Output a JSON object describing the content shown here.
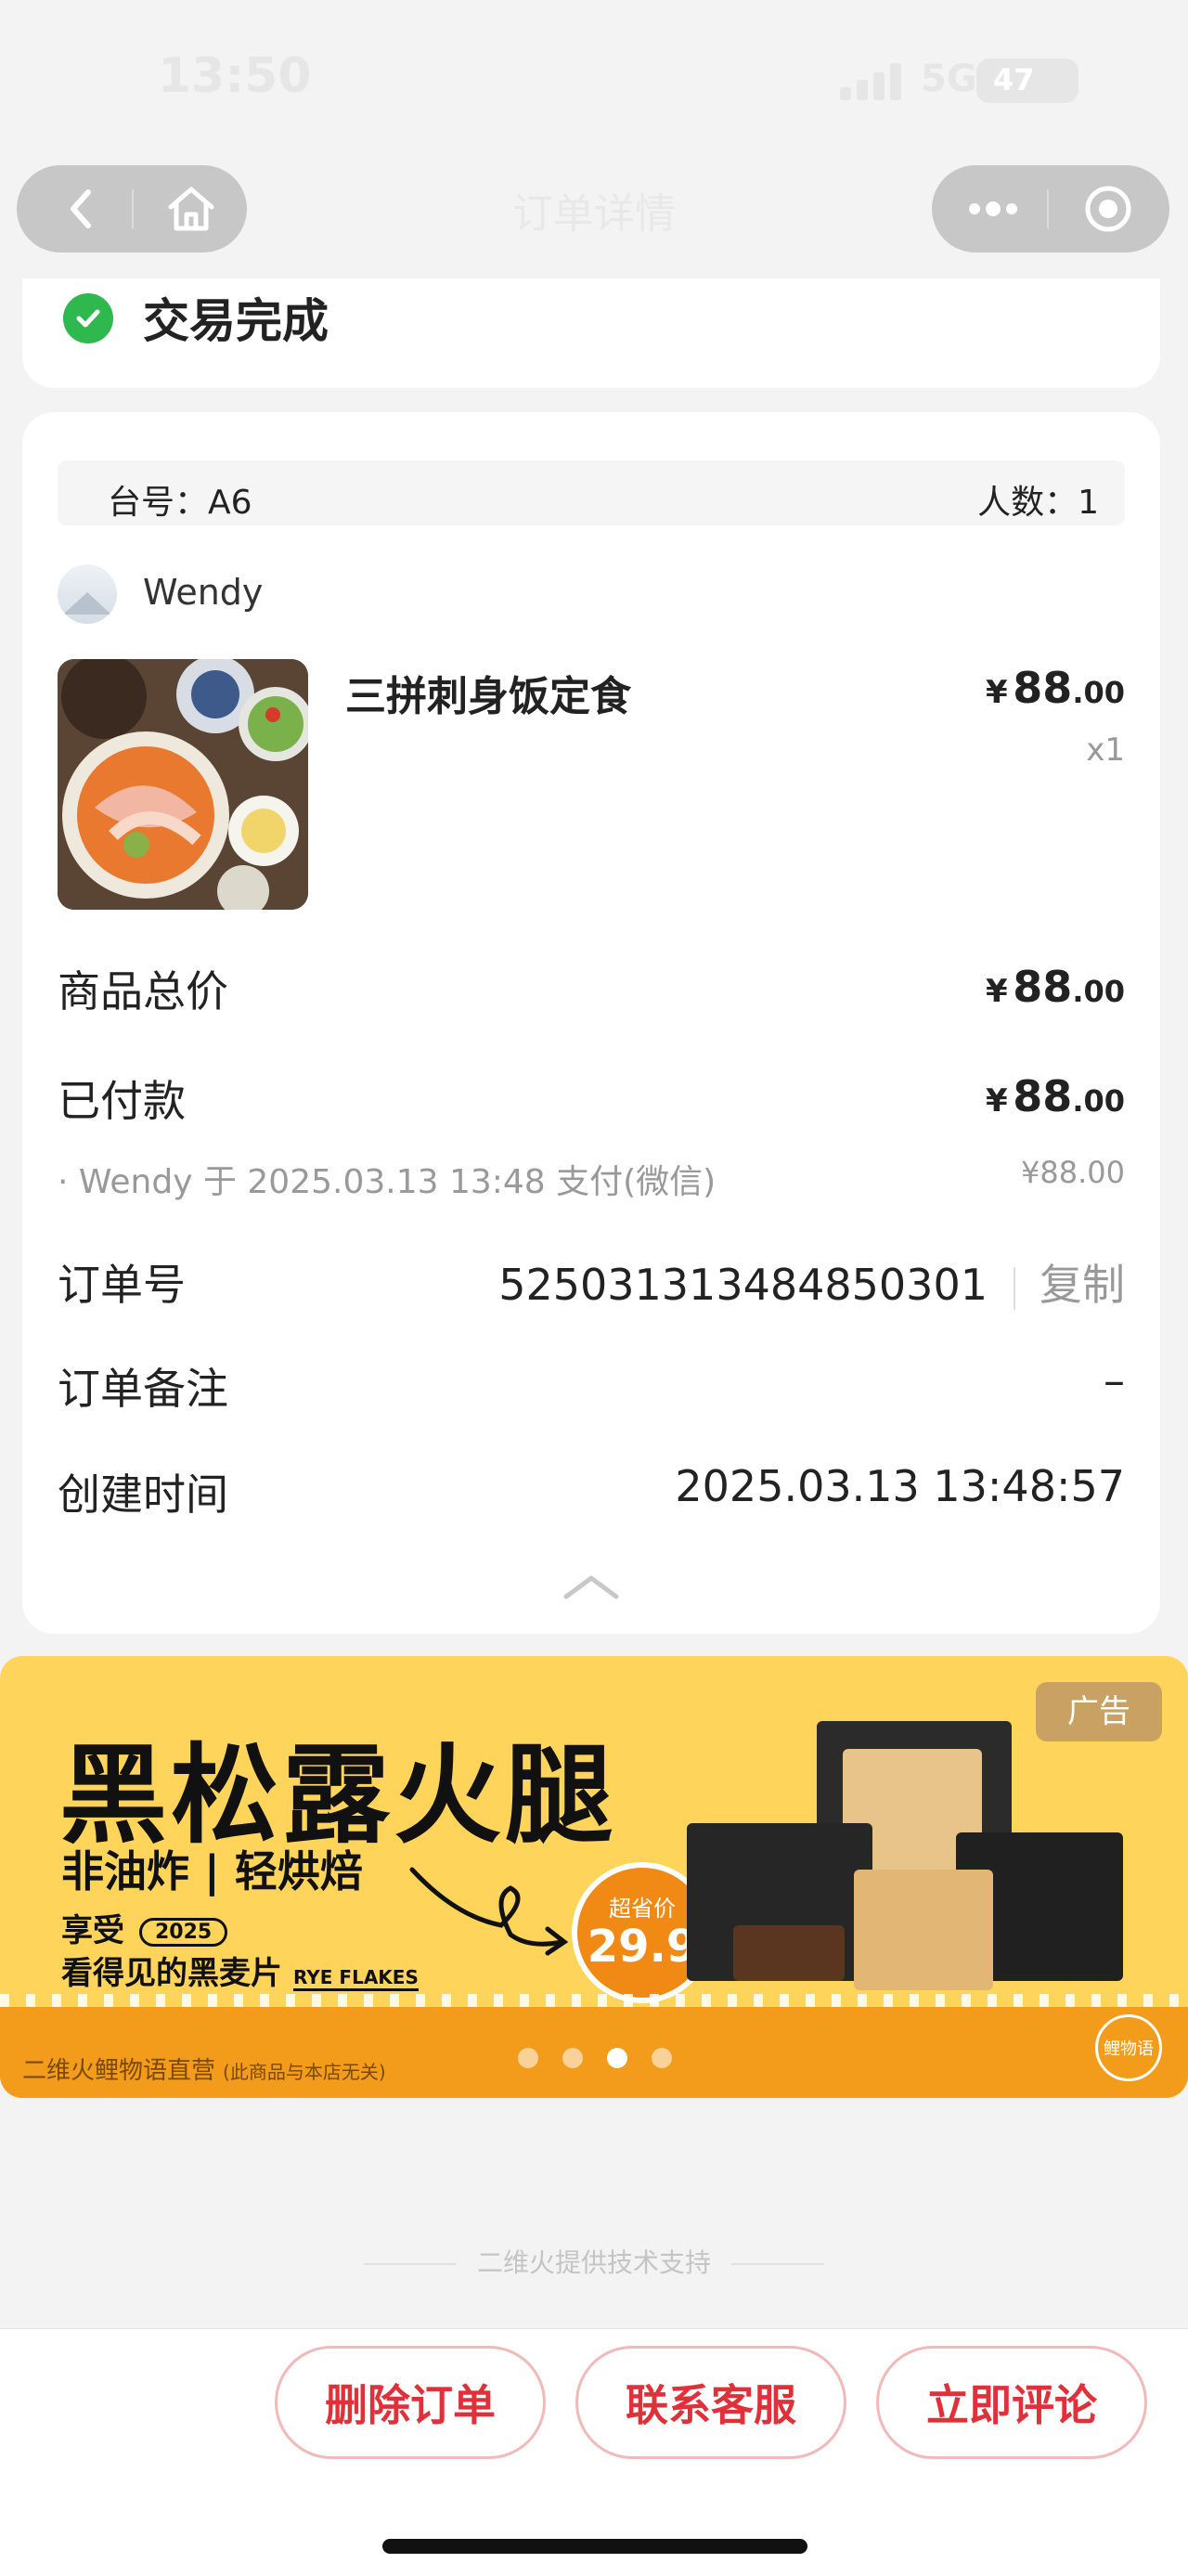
{
  "status_bar": {
    "time": "13:50",
    "network": "5G",
    "battery": "47"
  },
  "nav": {
    "title": "订单详情"
  },
  "order_status": {
    "text": "交易完成"
  },
  "table": {
    "table_label": "台号：A6",
    "people_label": "人数：1"
  },
  "user": {
    "name": "Wendy"
  },
  "item": {
    "name": "三拼刺身饭定食",
    "currency": "¥",
    "price_int": "88",
    "price_dec": ".00",
    "quantity": "x1"
  },
  "summary": {
    "subtotal_label": "商品总价",
    "subtotal_int": "88",
    "subtotal_dec": ".00",
    "paid_label": "已付款",
    "paid_int": "88",
    "paid_dec": ".00",
    "pay_detail": "· Wendy 于 2025.03.13 13:48 支付(微信)",
    "pay_amount": "¥88.00",
    "order_no_label": "订单号",
    "order_no": "525031313484850301",
    "copy_label": "复制",
    "remark_label": "订单备注",
    "remark": "–",
    "created_label": "创建时间",
    "created": "2025.03.13 13:48:57"
  },
  "ad": {
    "tag": "广告",
    "headline": "黑松露火腿",
    "sub": "非油炸 | 轻烘焙",
    "line1": "享受",
    "year": "2025",
    "line2": "看得见的黑麦片",
    "rye": "RYE FLAKES",
    "price_tag": "超省价",
    "price": "29.9",
    "footer": "二维火鲤物语直营",
    "footer_note": "(此商品与本店无关)",
    "logo": "鲤物语",
    "slide_count": 4,
    "active_slide": 3
  },
  "support": "二维火提供技术支持",
  "actions": {
    "delete": "删除订单",
    "contact": "联系客服",
    "review": "立即评论"
  },
  "colors": {
    "accent": "#e0303a",
    "success": "#2fb84d",
    "ad_bg": "#ffd45a"
  }
}
